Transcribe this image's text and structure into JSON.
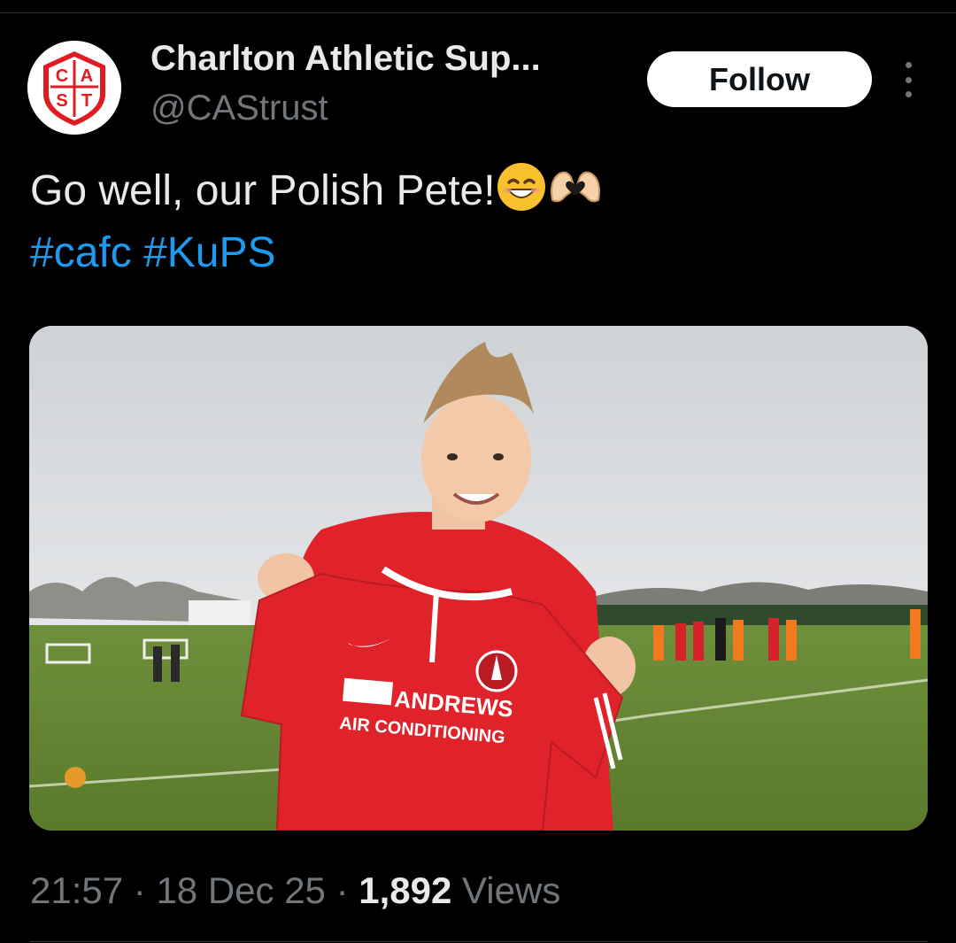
{
  "account": {
    "display_name": "Charlton Athletic Sup...",
    "handle": "@CAStrust",
    "avatar_letters": [
      "C",
      "A",
      "S",
      "T"
    ],
    "avatar_color": "#e11b22"
  },
  "actions": {
    "follow_label": "Follow",
    "more_icon": "more-vertical-icon"
  },
  "tweet": {
    "text": "Go well, our Polish Pete!",
    "emojis": [
      "smiling-face-icon",
      "heart-hands-icon"
    ],
    "hashtags": [
      "#cafc",
      "#KuPS"
    ]
  },
  "media": {
    "shirt_sponsor_line1": "ANDREWS",
    "shirt_sponsor_line2": "AIR CONDITIONING"
  },
  "meta": {
    "time": "21:57",
    "separator": "·",
    "date": "18 Dec 25",
    "views_count": "1,892",
    "views_label": "Views"
  },
  "colors": {
    "background": "#000000",
    "text_primary": "#e7e9ea",
    "text_secondary": "#71767b",
    "link": "#1d9bf0",
    "shirt_red": "#e0232b"
  }
}
